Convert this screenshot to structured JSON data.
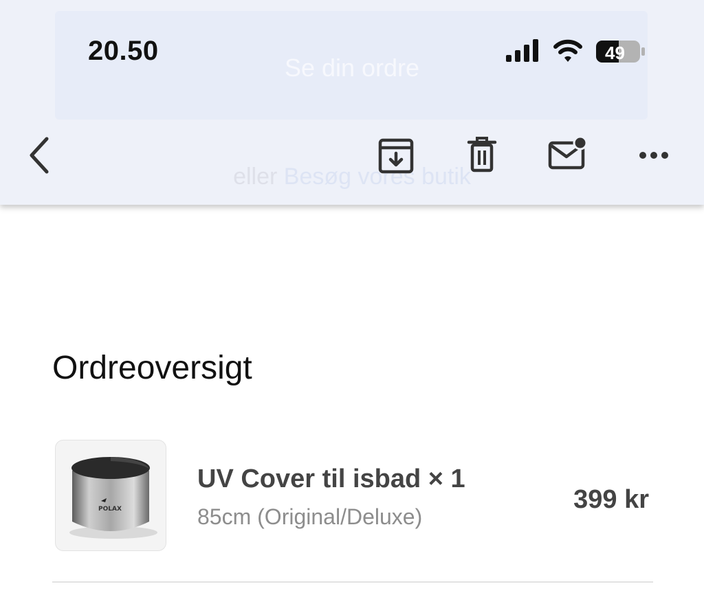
{
  "status_bar": {
    "time": "20.50",
    "battery_level": "49",
    "signal_icon": "cellular-signal-icon",
    "wifi_icon": "wifi-icon",
    "battery_icon": "battery-icon"
  },
  "background_content": {
    "button_text": "Se din ordre",
    "link_prefix": "eller",
    "link_text": "Besøg vores butik"
  },
  "toolbar": {
    "back_icon": "chevron-left-icon",
    "archive_icon": "archive-icon",
    "delete_icon": "trash-icon",
    "mark_unread_icon": "mail-unread-icon",
    "more_icon": "more-horizontal-icon"
  },
  "order_summary": {
    "title": "Ordreoversigt",
    "items": [
      {
        "name": "UV Cover til isbad × 1",
        "variant": "85cm (Original/Deluxe)",
        "price": "399 kr",
        "image_brand_text": "POLAX"
      }
    ]
  },
  "colors": {
    "header_bg": "#eef1f9",
    "text_primary": "#111111",
    "text_item": "#444444",
    "text_muted": "#8d8d8d"
  }
}
